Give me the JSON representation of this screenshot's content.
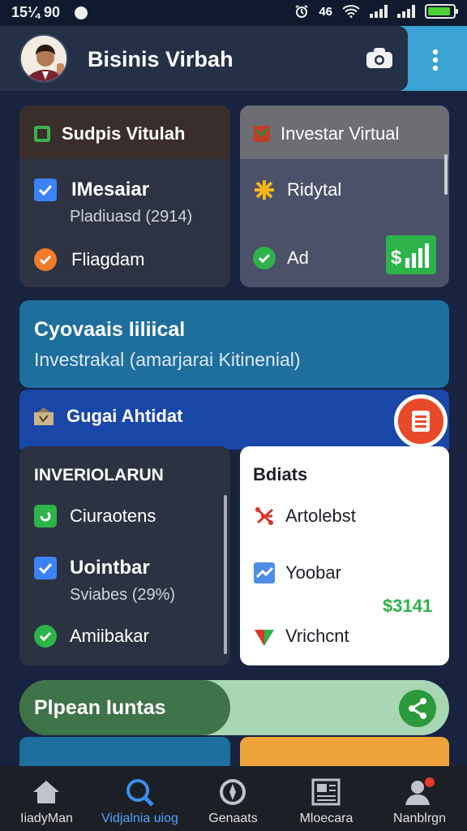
{
  "status_bar": {
    "time": "15¼ 90",
    "icons": [
      "alarm-icon",
      "wifi-icon",
      "signal-icon",
      "battery-icon"
    ],
    "network_label": "46"
  },
  "header": {
    "title": "Bisinis Virbah",
    "avatar_icon": "avatar",
    "camera_icon": "camera-icon",
    "more_icon": "more-vertical-icon"
  },
  "card_left": {
    "title": "Sudpis Vitulah",
    "items": [
      {
        "label": "IMesaiar",
        "sub": "Pladiuasd (2914)"
      },
      {
        "label": "Fliagdam"
      }
    ]
  },
  "card_right": {
    "title": "Investar Virtual",
    "items": [
      {
        "label": "Ridytal"
      },
      {
        "label": "Ad"
      }
    ]
  },
  "banner": {
    "title": "Cyovaais Iiliical",
    "subtitle": "Investrakal (amarjarai Kitinenial)"
  },
  "section": {
    "title": "Gugai Ahtidat"
  },
  "list_left": {
    "title": "INVERIOLARUN",
    "items": [
      {
        "label": "Ciuraotens"
      },
      {
        "label": "Uointbar",
        "sub": "Sviabes (29%)"
      },
      {
        "label": "Amiibakar"
      }
    ]
  },
  "list_right": {
    "title": "Bdiats",
    "items": [
      {
        "label": "Artolebst"
      },
      {
        "label": "Yoobar"
      },
      {
        "label": "Vrichcnt"
      }
    ],
    "amount": "$3141"
  },
  "pill": {
    "label": "Plpean Iuntas"
  },
  "bottom_nav": [
    {
      "label": "IiadyMan",
      "icon": "home-icon"
    },
    {
      "label": "Vidjalnia uiog",
      "icon": "search-icon"
    },
    {
      "label": "Genaats",
      "icon": "location-icon"
    },
    {
      "label": "Mloecara",
      "icon": "newspaper-icon"
    },
    {
      "label": "Nanblrgn",
      "icon": "profile-icon"
    }
  ],
  "colors": {
    "accent": "#3ba3d3",
    "brand_blue": "#1947a8",
    "fab": "#e8492a",
    "green": "#2db34a"
  }
}
